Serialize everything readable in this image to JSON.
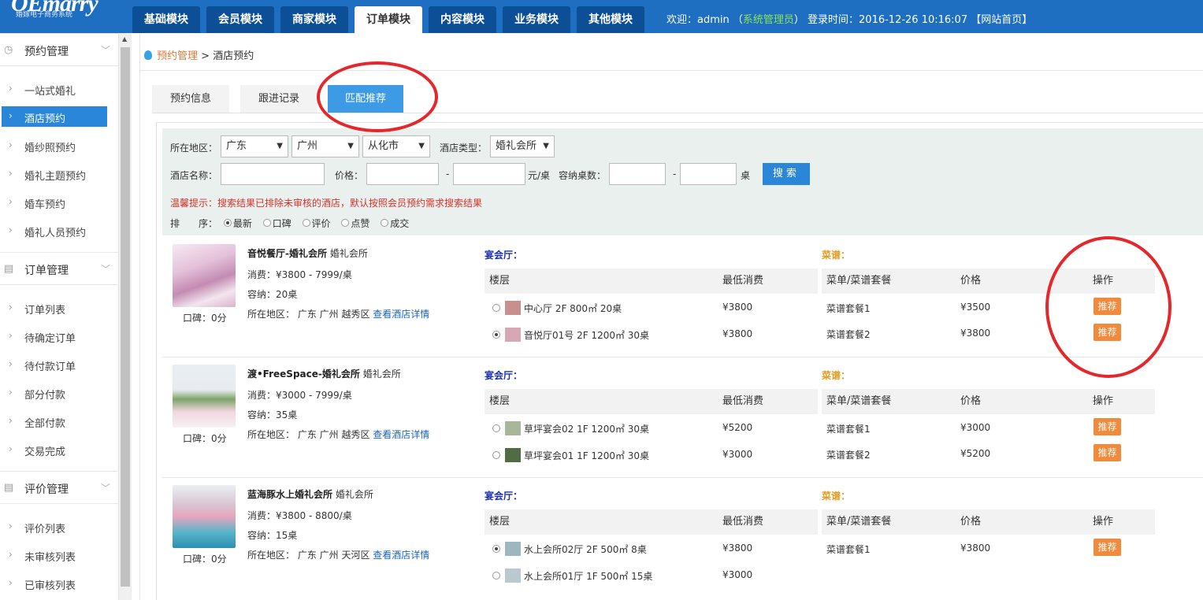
{
  "app": {
    "logo": "OEmarry",
    "logo_sub": "婚嫁电子商务系统"
  },
  "nav": {
    "tabs": [
      {
        "label": "基础模块",
        "active": false
      },
      {
        "label": "会员模块",
        "active": false
      },
      {
        "label": "商家模块",
        "active": false
      },
      {
        "label": "订单模块",
        "active": true
      },
      {
        "label": "内容模块",
        "active": false
      },
      {
        "label": "业务模块",
        "active": false
      },
      {
        "label": "其他模块",
        "active": false
      }
    ],
    "welcome_prefix": "欢迎：admin （",
    "welcome_role": "系统管理员",
    "welcome_suffix": "） 登录时间：2016-12-26 10:16:07 【网站首页】"
  },
  "sidebar": {
    "sections": [
      {
        "title": "预约管理",
        "icon": "clock-icon",
        "items": [
          "一站式婚礼",
          "酒店预约",
          "婚纱照预约",
          "婚礼主题预约",
          "婚车预约",
          "婚礼人员预约"
        ]
      },
      {
        "title": "订单管理",
        "icon": "clipboard-icon",
        "items": [
          "订单列表",
          "待确定订单",
          "待付款订单",
          "部分付款",
          "全部付款",
          "交易完成"
        ]
      },
      {
        "title": "评价管理",
        "icon": "clipboard-icon",
        "items": [
          "评价列表",
          "未审核列表",
          "已审核列表"
        ]
      }
    ],
    "active_item": "酒店预约"
  },
  "breadcrumb": {
    "parent": "预约管理",
    "sep": ">",
    "current": "酒店预约"
  },
  "tabs": [
    {
      "label": "预约信息",
      "active": false
    },
    {
      "label": "跟进记录",
      "active": false
    },
    {
      "label": "匹配推荐",
      "active": true
    }
  ],
  "filter": {
    "region_label": "所在地区：",
    "province": "广东",
    "city": "广州",
    "district": "从化市",
    "type_label": "酒店类型：",
    "type": "婚礼会所",
    "name_label": "酒店名称：",
    "price_label": "价格：",
    "dash": "-",
    "price_unit": "元/桌",
    "tables_label": "容纳桌数：",
    "tables_unit": "桌",
    "search_button": "搜索",
    "tip": "温馨提示：搜索结果已排除未审核的酒店，默认按照会员预约需求搜索结果",
    "sort_label": "排　　序：",
    "sort_options": [
      "最新",
      "口碑",
      "评价",
      "点赞",
      "成交"
    ],
    "sort_selected": "最新"
  },
  "columns": {
    "hall_title": "宴会厅：",
    "menu_title": "菜谱：",
    "floor": "楼层",
    "min_spend": "最低消费",
    "menu": "菜单/菜谱套餐",
    "price": "价格",
    "action": "操作"
  },
  "hotels": [
    {
      "name": "音悦餐厅-婚礼会所",
      "type": "婚礼会所",
      "spend": "消费：¥3800 - 7999/桌",
      "capacity": "容纳：20桌",
      "region": "所在地区： 广东 广州 越秀区",
      "details_link": "查看酒店详情",
      "rating": "口碑：0分",
      "halls": [
        {
          "name": "中心厅 2F 800㎡ 20桌",
          "min": "¥3800",
          "selected": false
        },
        {
          "name": "音悦厅01号 2F 1200㎡ 30桌",
          "min": "¥3800",
          "selected": true
        }
      ],
      "menus": [
        {
          "name": "菜谱套餐1",
          "price": "¥3500",
          "action": "推荐"
        },
        {
          "name": "菜谱套餐2",
          "price": "¥3800",
          "action": "推荐"
        }
      ]
    },
    {
      "name": "渡•FreeSpace-婚礼会所",
      "type": "婚礼会所",
      "spend": "消费：¥3000 - 7999/桌",
      "capacity": "容纳：35桌",
      "region": "所在地区： 广东 广州 越秀区",
      "details_link": "查看酒店详情",
      "rating": "口碑：0分",
      "halls": [
        {
          "name": "草坪宴会02 1F 1200㎡ 30桌",
          "min": "¥5200",
          "selected": false
        },
        {
          "name": "草坪宴会01 1F 1200㎡ 30桌",
          "min": "¥3000",
          "selected": false
        }
      ],
      "menus": [
        {
          "name": "菜谱套餐1",
          "price": "¥3000",
          "action": "推荐"
        },
        {
          "name": "菜谱套餐2",
          "price": "¥5200",
          "action": "推荐"
        }
      ]
    },
    {
      "name": "蓝海豚水上婚礼会所",
      "type": "婚礼会所",
      "spend": "消费：¥3800 - 8800/桌",
      "capacity": "容纳：15桌",
      "region": "所在地区： 广东 广州 天河区",
      "details_link": "查看酒店详情",
      "rating": "口碑：0分",
      "halls": [
        {
          "name": "水上会所02厅 2F 500㎡ 8桌",
          "min": "¥3800",
          "selected": true
        },
        {
          "name": "水上会所01厅 1F 500㎡ 15桌",
          "min": "¥3000",
          "selected": false
        }
      ],
      "menus": [
        {
          "name": "菜谱套餐1",
          "price": "¥3800",
          "action": "推荐"
        }
      ]
    }
  ],
  "colors": {
    "nav_bg": "#1e6fc1",
    "accent": "#2a86d8",
    "recommend": "#f08a3c",
    "annotation": "#e3272b"
  }
}
